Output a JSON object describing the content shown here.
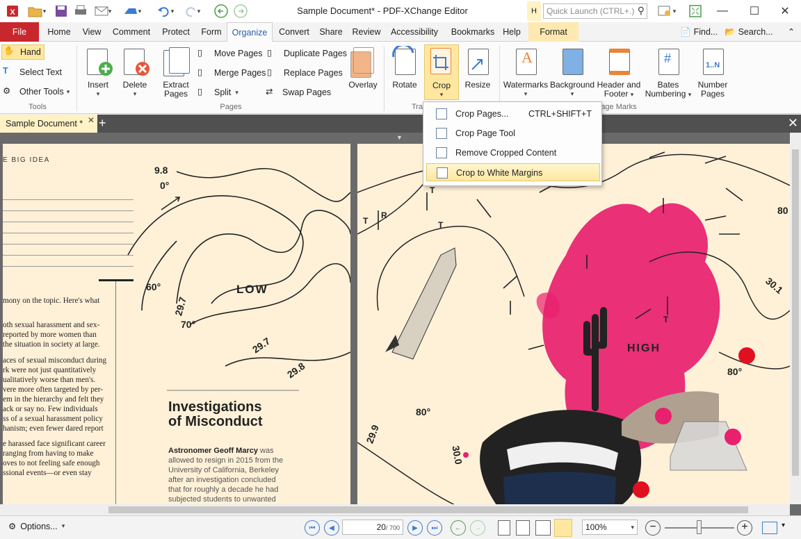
{
  "titlebar": {
    "document_title": "Sample Document* - PDF-XChange Editor",
    "quick_launch_placeholder": "Quick Launch (CTRL+.)",
    "hint_letter": "H"
  },
  "menu_tabs": [
    "File",
    "Home",
    "View",
    "Comment",
    "Protect",
    "Form",
    "Organize",
    "Convert",
    "Share",
    "Review",
    "Accessibility",
    "Bookmarks",
    "Help",
    "Format"
  ],
  "menu_right": {
    "find": "Find...",
    "search": "Search..."
  },
  "ribbon": {
    "tools": {
      "hand": "Hand",
      "select_text": "Select Text",
      "other_tools": "Other Tools",
      "group": "Tools"
    },
    "pages": {
      "insert": "Insert",
      "delete": "Delete",
      "extract": "Extract",
      "extract2": "Pages",
      "move": "Move Pages",
      "merge": "Merge Pages",
      "split": "Split",
      "duplicate": "Duplicate Pages",
      "replace": "Replace Pages",
      "swap": "Swap Pages",
      "overlay": "Overlay",
      "group": "Pages"
    },
    "transform": {
      "rotate": "Rotate",
      "crop": "Crop",
      "resize": "Resize",
      "group": "Tra"
    },
    "marks": {
      "watermarks": "Watermarks",
      "background": "Background",
      "header1": "Header and",
      "header2": "Footer",
      "bates1": "Bates",
      "bates2": "Numbering",
      "number1": "Number",
      "number2": "Pages",
      "group": "age Marks"
    }
  },
  "doc_tab": {
    "label": "Sample Document *"
  },
  "crop_menu": {
    "items": [
      {
        "label": "Crop Pages...",
        "shortcut": "CTRL+SHIFT+T"
      },
      {
        "label": "Crop Page Tool",
        "shortcut": ""
      },
      {
        "label": "Remove Cropped Content",
        "shortcut": ""
      },
      {
        "label": "Crop to White Margins",
        "shortcut": ""
      }
    ]
  },
  "document": {
    "header_text": "E BIG IDEA",
    "left_column": [
      "mony on the topic. Here's what",
      "oth sexual harassment and sex-",
      "reported by more women than",
      "the situation in society at large.",
      "aces of sexual misconduct during",
      "rk were not just quantitatively",
      "ualitatively worse than men's.",
      "vere more often targeted by per-",
      "em in the hierarchy and felt they",
      "ack or say no. Few individuals",
      "ss of a sexual harassment policy",
      "hanism; even fewer dared report",
      "e harassed face significant career",
      "ranging from having to make",
      "oves to not feeling safe enough",
      "ssional events—or even stay"
    ],
    "heading_line1": "Investigations",
    "heading_line2": "of Misconduct",
    "body_bold": "Astronomer Geoff Marcy",
    "body_lines": [
      "was",
      "allowed to resign in 2015 from the",
      "University of California, Berkeley",
      "after an investigation concluded",
      "that for roughly a decade he had",
      "subjected students to unwanted"
    ],
    "weather_labels": {
      "l1": "9.8",
      "l2": "0°",
      "l3": "60°",
      "l4": "29.7",
      "l5": "70°",
      "l6": "LOW",
      "l7": "29.7",
      "l8": "29.8",
      "r1": "T",
      "r2": "R",
      "r3": "T",
      "r4": "T",
      "r5": "HIGH",
      "r6": "80°",
      "r7": "80°",
      "r8": "29.9",
      "r9": "30.0",
      "r10": "30.1",
      "r11": "80",
      "r12": "T"
    }
  },
  "statusbar": {
    "options": "Options...",
    "page_current": "20",
    "page_total": "/ 700",
    "zoom": "100%"
  },
  "colors": {
    "file_tab": "#c8272e",
    "accent_blue": "#3a7bd5",
    "page_bg": "#fff1d8",
    "magenta": "#e8206e",
    "highlight": "#ffe7a0"
  }
}
